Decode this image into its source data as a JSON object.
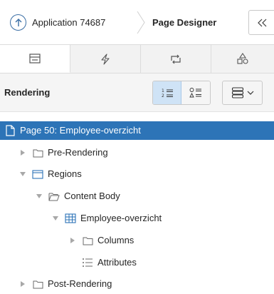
{
  "header": {
    "app_label": "Application 74687",
    "page_designer_label": "Page Designer"
  },
  "tabs": [
    {
      "icon": "rendering-tab-icon",
      "active": true
    },
    {
      "icon": "lightning-bolt-icon",
      "active": false
    },
    {
      "icon": "processing-loop-icon",
      "active": false
    },
    {
      "icon": "shared-components-icon",
      "active": false
    }
  ],
  "toolbar": {
    "title": "Rendering",
    "view_order_label": "1 2",
    "view_type_label": "○ △"
  },
  "tree": {
    "page": "Page 50: Employee-overzicht",
    "pre_rendering": "Pre-Rendering",
    "regions": "Regions",
    "content_body": "Content Body",
    "region_name": "Employee-overzicht",
    "columns": "Columns",
    "attributes": "Attributes",
    "post_rendering": "Post-Rendering"
  },
  "colors": {
    "selected_bg": "#2d74b7",
    "accent": "#3a6ea5",
    "active_seg": "#cfe3f6"
  }
}
